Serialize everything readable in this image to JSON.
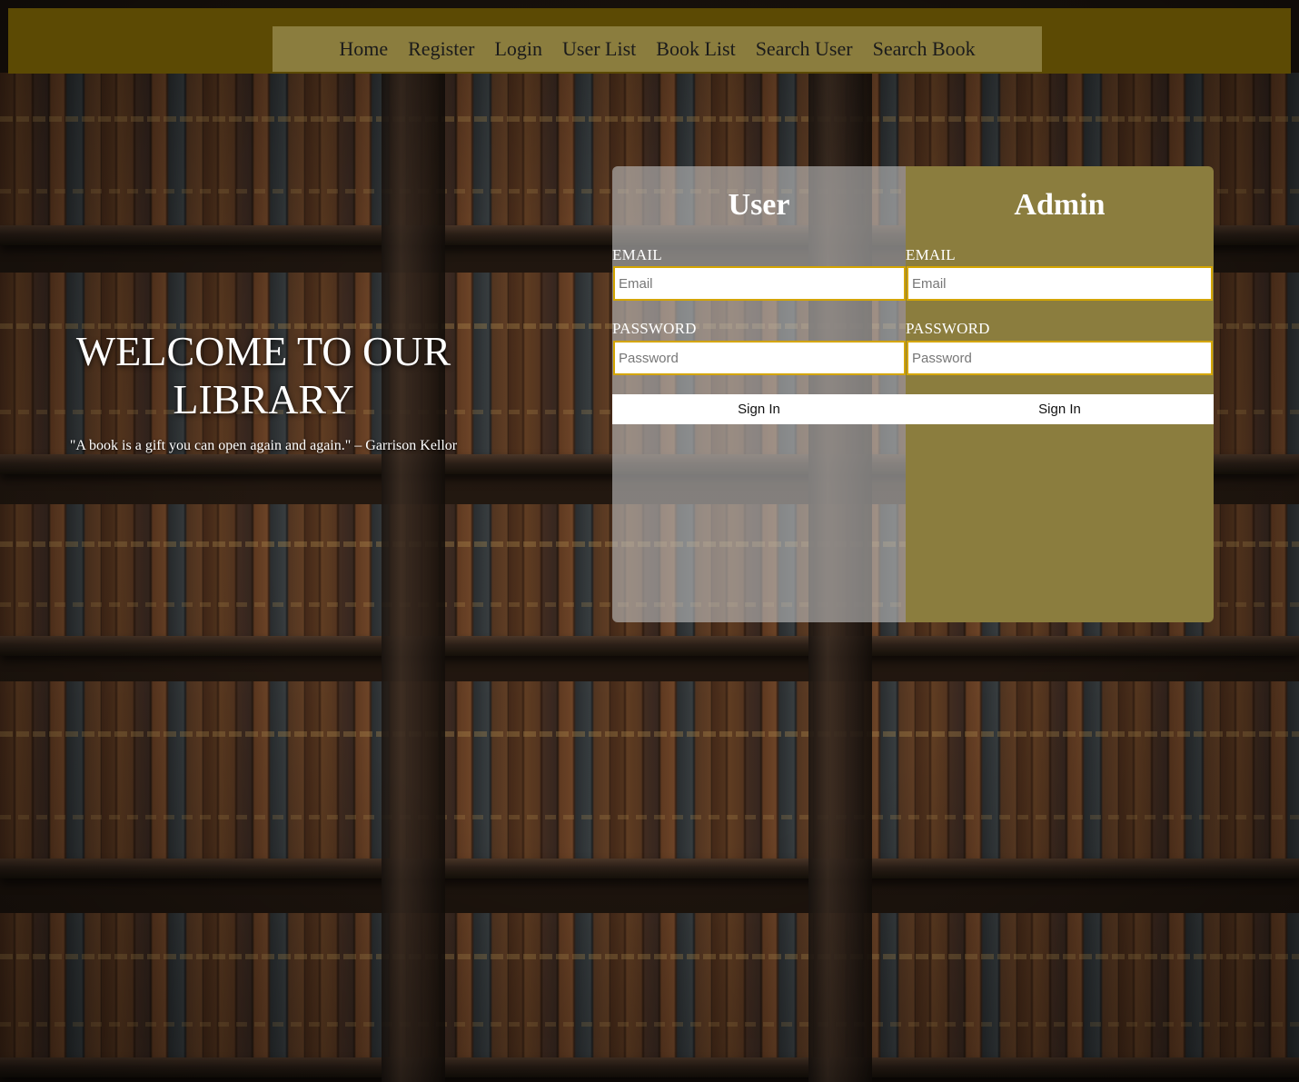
{
  "nav": {
    "items": [
      "Home",
      "Register",
      "Login",
      "User List",
      "Book List",
      "Search User",
      "Search Book"
    ]
  },
  "hero": {
    "title": "WELCOME TO OUR LIBRARY",
    "quote": "\"A book is a gift you can open again and again.\" – Garrison Kellor"
  },
  "user_form": {
    "heading": "User",
    "email_label": "EMAIL",
    "email_placeholder": "Email",
    "password_label": "PASSWORD",
    "password_placeholder": "Password",
    "submit_label": "Sign In"
  },
  "admin_form": {
    "heading": "Admin",
    "email_label": "EMAIL",
    "email_placeholder": "Email",
    "password_label": "PASSWORD",
    "password_placeholder": "Password",
    "submit_label": "Sign In"
  },
  "colors": {
    "topbar": "#5c4a04",
    "nav_bg": "#8b7d3e",
    "admin_panel": "#8b7d3e",
    "input_border": "#d4a500"
  }
}
